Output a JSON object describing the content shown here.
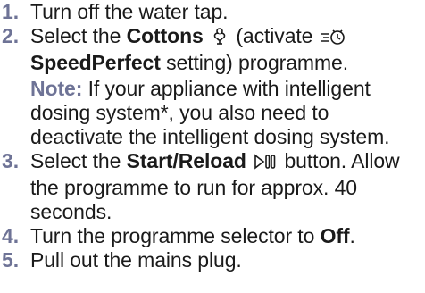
{
  "steps": [
    {
      "number": "1.",
      "text": "Turn off the water tap."
    },
    {
      "number": "2.",
      "pre": "Select the ",
      "programme_name": "Cottons",
      "mid": " (activate ",
      "setting_name": "SpeedPerfect",
      "post": " setting) programme.",
      "cottons_icon": "cotton-flower-icon",
      "speedperfect_icon": "speedperfect-clock-icon",
      "note_label": "Note:",
      "note_text": " If your appliance with intelligent dosing system*, you also need to deactivate the intelligent dosing system."
    },
    {
      "number": "3.",
      "pre": "Select the ",
      "button_name": "Start/Reload",
      "post": " button. Allow the programme to run for approx. 40 seconds.",
      "icon": "start-pause-icon"
    },
    {
      "number": "4.",
      "pre": "Turn the programme selector to ",
      "bold": "Off",
      "post": "."
    },
    {
      "number": "5.",
      "text": "Pull out the mains plug."
    }
  ],
  "colors": {
    "numbers": "#6e7396",
    "text": "#1a1a1a"
  }
}
